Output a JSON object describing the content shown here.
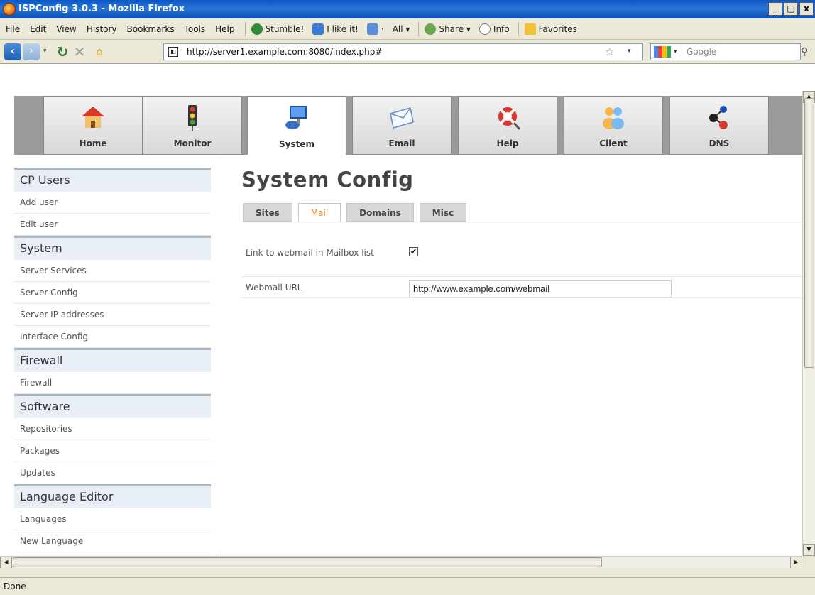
{
  "window": {
    "title": "ISPConfig 3.0.3 - Mozilla Firefox",
    "min": "_",
    "max": "□",
    "close": "x"
  },
  "menu": [
    "File",
    "Edit",
    "View",
    "History",
    "Bookmarks",
    "Tools",
    "Help"
  ],
  "toolbar": {
    "stumble": "Stumble!",
    "ilike": "I like it!",
    "all": "All",
    "share": "Share",
    "info": "Info",
    "favorites": "Favorites"
  },
  "nav": {
    "url": "http://server1.example.com:8080/index.php#",
    "search_placeholder": "Google"
  },
  "modules": [
    {
      "label": "Home",
      "icon": "house-icon"
    },
    {
      "label": "Monitor",
      "icon": "traffic-light-icon"
    },
    {
      "label": "System",
      "icon": "computer-icon",
      "active": true
    },
    {
      "label": "Email",
      "icon": "envelope-icon"
    },
    {
      "label": "Help",
      "icon": "lifebuoy-icon"
    },
    {
      "label": "Client",
      "icon": "users-icon"
    },
    {
      "label": "DNS",
      "icon": "network-icon"
    }
  ],
  "sidebar": {
    "sections": [
      {
        "title": "CP Users",
        "items": [
          "Add user",
          "Edit user"
        ]
      },
      {
        "title": "System",
        "items": [
          "Server Services",
          "Server Config",
          "Server IP addresses",
          "Interface Config"
        ]
      },
      {
        "title": "Firewall",
        "items": [
          "Firewall"
        ]
      },
      {
        "title": "Software",
        "items": [
          "Repositories",
          "Packages",
          "Updates"
        ]
      },
      {
        "title": "Language Editor",
        "items": [
          "Languages",
          "New Language"
        ]
      }
    ]
  },
  "content": {
    "title": "System Config",
    "tabs": [
      "Sites",
      "Mail",
      "Domains",
      "Misc"
    ],
    "active_tab": "Mail",
    "fields": {
      "webmail_link_label": "Link to webmail in Mailbox list",
      "webmail_link_checked": true,
      "webmail_url_label": "Webmail URL",
      "webmail_url_value": "http://www.example.com/webmail"
    }
  },
  "status": "Done"
}
